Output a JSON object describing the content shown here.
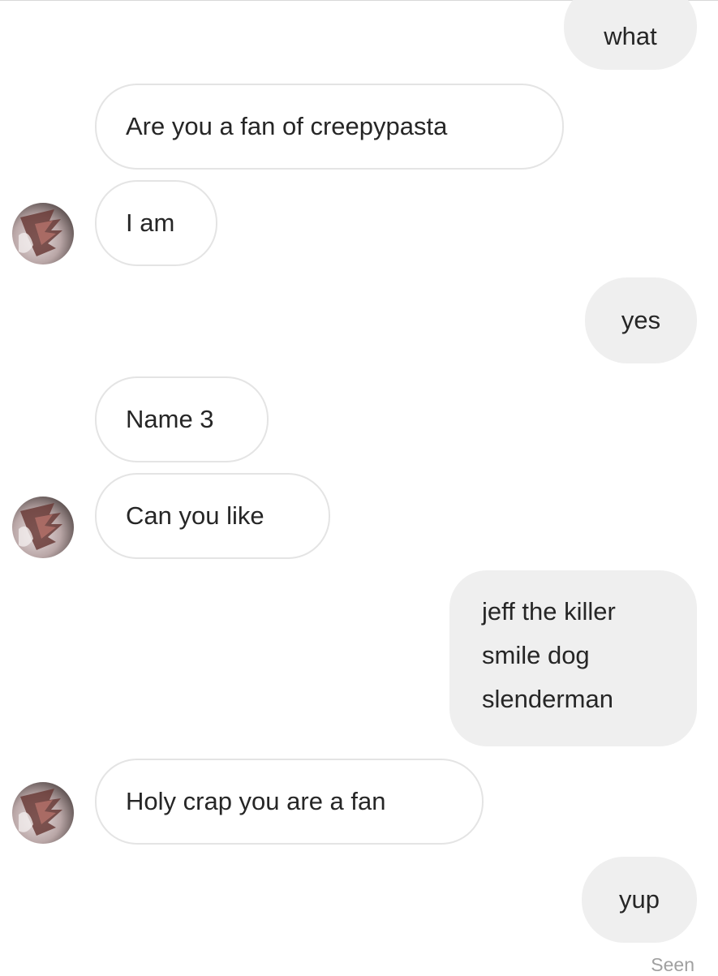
{
  "colors": {
    "received_bg": "#ffffff",
    "received_border": "#e4e4e4",
    "sent_bg": "#efefef",
    "text": "#262626",
    "seen": "#a0a0a0"
  },
  "messages": [
    {
      "from": "me",
      "text": "what"
    },
    {
      "from": "them",
      "text": "Are you a fan of creepypasta"
    },
    {
      "from": "them",
      "text": "I am"
    },
    {
      "from": "me",
      "text": "yes"
    },
    {
      "from": "them",
      "text": "Name 3"
    },
    {
      "from": "them",
      "text": "Can you like"
    },
    {
      "from": "me",
      "lines": [
        "jeff the killer",
        "smile dog",
        "slenderman"
      ]
    },
    {
      "from": "them",
      "text": "Holy crap you are a fan"
    },
    {
      "from": "me",
      "text": "yup"
    }
  ],
  "status": {
    "seen_label": "Seen"
  },
  "avatar_icon": "user-avatar-icon"
}
